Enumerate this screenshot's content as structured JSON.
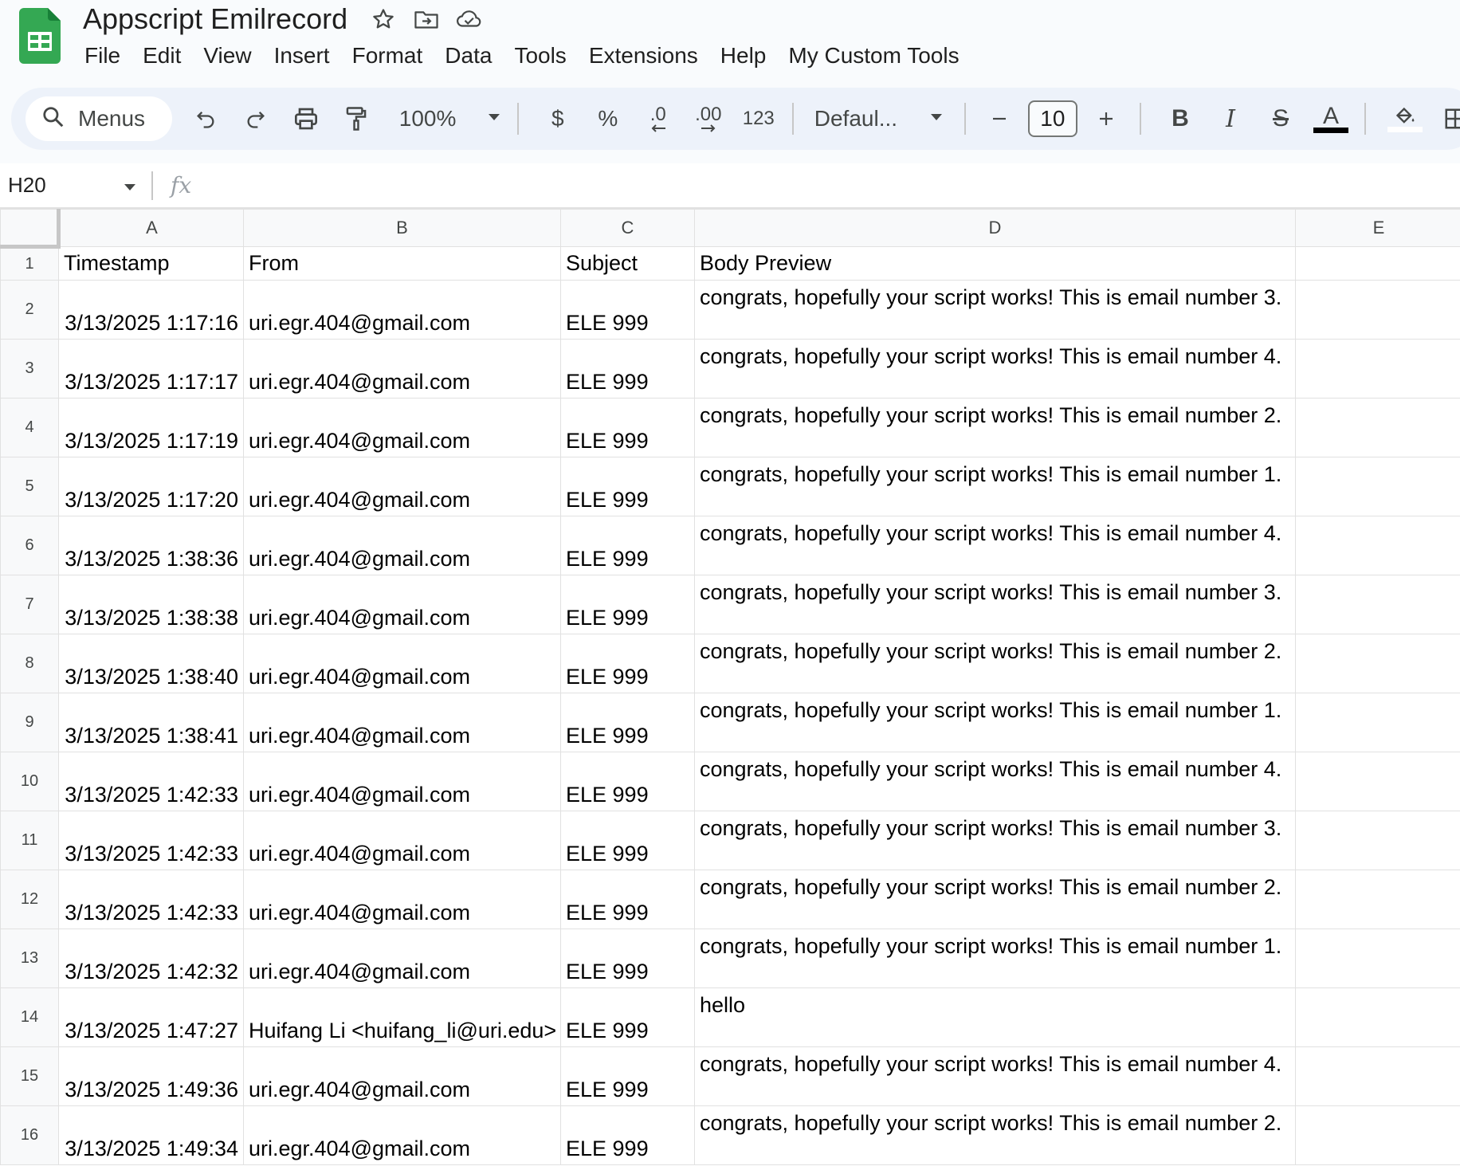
{
  "app": {
    "title": "Appscript Emilrecord",
    "title_icons": [
      "star-icon",
      "move-folder-icon",
      "cloud-saved-icon"
    ],
    "brand_color": "#34a853"
  },
  "menu": [
    "File",
    "Edit",
    "View",
    "Insert",
    "Format",
    "Data",
    "Tools",
    "Extensions",
    "Help",
    "My Custom Tools"
  ],
  "toolbar": {
    "search_label": "Menus",
    "zoom": "100%",
    "currency": "$",
    "percent": "%",
    "decrease_decimal": ".0",
    "increase_decimal": ".00",
    "number_format": "123",
    "font": "Defaul...",
    "font_size": "10",
    "bold": "B",
    "italic": "I",
    "strikethrough": "S",
    "text_color": "A",
    "icons": [
      "search-icon",
      "undo-icon",
      "redo-icon",
      "print-icon",
      "paint-format-icon",
      "bold-icon",
      "italic-icon",
      "strikethrough-icon",
      "text-color-icon",
      "fill-color-icon",
      "borders-icon"
    ]
  },
  "formula_bar": {
    "cell_ref": "H20",
    "fx": "fx",
    "value": ""
  },
  "sheet": {
    "columns": [
      "A",
      "B",
      "C",
      "D",
      "E"
    ],
    "header_row": {
      "number": "1",
      "cells": [
        "Timestamp",
        "From",
        "Subject",
        "Body Preview",
        ""
      ]
    },
    "rows": [
      {
        "n": "2",
        "timestamp": "3/13/2025 1:17:16",
        "from": "uri.egr.404@gmail.com",
        "subject": "ELE 999",
        "body": "congrats, hopefully your script works! This is email number 3."
      },
      {
        "n": "3",
        "timestamp": "3/13/2025 1:17:17",
        "from": "uri.egr.404@gmail.com",
        "subject": "ELE 999",
        "body": "congrats, hopefully your script works! This is email number 4."
      },
      {
        "n": "4",
        "timestamp": "3/13/2025 1:17:19",
        "from": "uri.egr.404@gmail.com",
        "subject": "ELE 999",
        "body": "congrats, hopefully your script works! This is email number 2."
      },
      {
        "n": "5",
        "timestamp": "3/13/2025 1:17:20",
        "from": "uri.egr.404@gmail.com",
        "subject": "ELE 999",
        "body": "congrats, hopefully your script works! This is email number 1."
      },
      {
        "n": "6",
        "timestamp": "3/13/2025 1:38:36",
        "from": "uri.egr.404@gmail.com",
        "subject": "ELE 999",
        "body": "congrats, hopefully your script works! This is email number 4."
      },
      {
        "n": "7",
        "timestamp": "3/13/2025 1:38:38",
        "from": "uri.egr.404@gmail.com",
        "subject": "ELE 999",
        "body": "congrats, hopefully your script works! This is email number 3."
      },
      {
        "n": "8",
        "timestamp": "3/13/2025 1:38:40",
        "from": "uri.egr.404@gmail.com",
        "subject": "ELE 999",
        "body": "congrats, hopefully your script works! This is email number 2."
      },
      {
        "n": "9",
        "timestamp": "3/13/2025 1:38:41",
        "from": "uri.egr.404@gmail.com",
        "subject": "ELE 999",
        "body": "congrats, hopefully your script works! This is email number 1."
      },
      {
        "n": "10",
        "timestamp": "3/13/2025 1:42:33",
        "from": "uri.egr.404@gmail.com",
        "subject": "ELE 999",
        "body": "congrats, hopefully your script works! This is email number 4."
      },
      {
        "n": "11",
        "timestamp": "3/13/2025 1:42:33",
        "from": "uri.egr.404@gmail.com",
        "subject": "ELE 999",
        "body": "congrats, hopefully your script works! This is email number 3."
      },
      {
        "n": "12",
        "timestamp": "3/13/2025 1:42:33",
        "from": "uri.egr.404@gmail.com",
        "subject": "ELE 999",
        "body": "congrats, hopefully your script works! This is email number 2."
      },
      {
        "n": "13",
        "timestamp": "3/13/2025 1:42:32",
        "from": "uri.egr.404@gmail.com",
        "subject": "ELE 999",
        "body": "congrats, hopefully your script works! This is email number 1."
      },
      {
        "n": "14",
        "timestamp": "3/13/2025 1:47:27",
        "from": "Huifang Li <huifang_li@uri.edu>",
        "subject": "ELE 999",
        "body": "hello"
      },
      {
        "n": "15",
        "timestamp": "3/13/2025 1:49:36",
        "from": "uri.egr.404@gmail.com",
        "subject": "ELE 999",
        "body": "congrats, hopefully your script works! This is email number 4."
      },
      {
        "n": "16",
        "timestamp": "3/13/2025 1:49:34",
        "from": "uri.egr.404@gmail.com",
        "subject": "ELE 999",
        "body": "congrats, hopefully your script works! This is email number 2."
      }
    ]
  }
}
